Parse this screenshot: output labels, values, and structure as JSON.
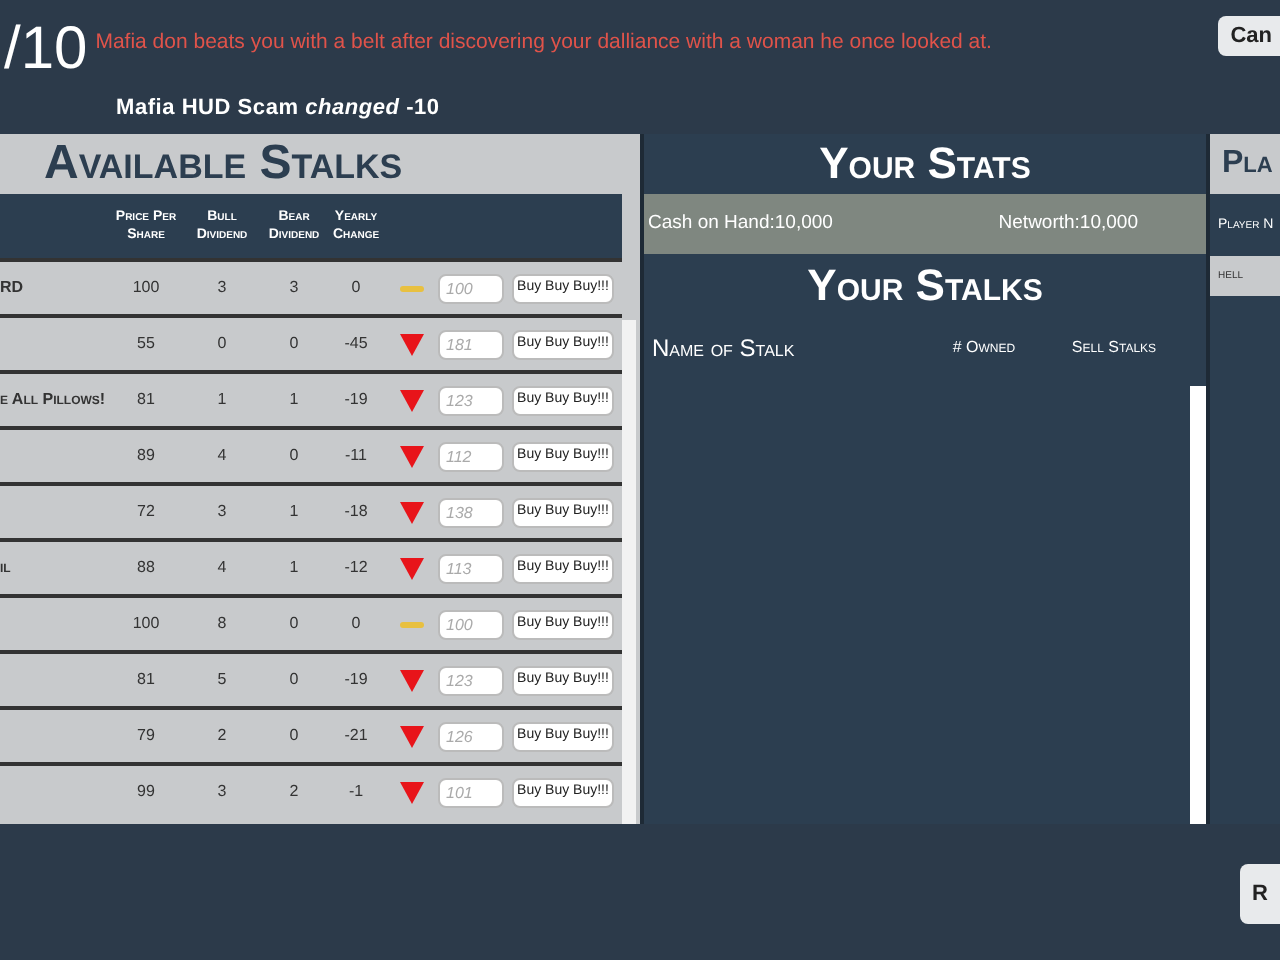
{
  "header": {
    "round": "/10",
    "message": "Mafia don beats you with a belt after discovering your dalliance with a woman he once looked at.",
    "event": "Mafia HUD Scam *changed* -10",
    "cancel_button": "Can"
  },
  "market": {
    "title": "Available Stalks",
    "columns": [
      "Price Per Share",
      "Bull Dividend",
      "Bear Dividend",
      "Yearly Change"
    ],
    "rows": [
      {
        "name": "RD",
        "price": "100",
        "bull": "3",
        "bear": "3",
        "change": "0",
        "kind": "flat",
        "placeholder": "100",
        "button": "Buy Buy Buy!!!"
      },
      {
        "price": "55",
        "bull": "0",
        "bear": "0",
        "change": "-45",
        "kind": "down",
        "placeholder": "181",
        "button": "Buy Buy Buy!!!"
      },
      {
        "name": "e All Pillows!",
        "price": "81",
        "bull": "1",
        "bear": "1",
        "change": "-19",
        "kind": "down",
        "placeholder": "123",
        "button": "Buy Buy Buy!!!"
      },
      {
        "price": "89",
        "bull": "4",
        "bear": "0",
        "change": "-11",
        "kind": "down",
        "placeholder": "112",
        "button": "Buy Buy Buy!!!"
      },
      {
        "price": "72",
        "bull": "3",
        "bear": "1",
        "change": "-18",
        "kind": "down",
        "placeholder": "138",
        "button": "Buy Buy Buy!!!"
      },
      {
        "name": "il",
        "price": "88",
        "bull": "4",
        "bear": "1",
        "change": "-12",
        "kind": "down",
        "placeholder": "113",
        "button": "Buy Buy Buy!!!"
      },
      {
        "price": "100",
        "bull": "8",
        "bear": "0",
        "change": "0",
        "kind": "flat",
        "placeholder": "100",
        "button": "Buy Buy Buy!!!"
      },
      {
        "price": "81",
        "bull": "5",
        "bear": "0",
        "change": "-19",
        "kind": "down",
        "placeholder": "123",
        "button": "Buy Buy Buy!!!"
      },
      {
        "price": "79",
        "bull": "2",
        "bear": "0",
        "change": "-21",
        "kind": "down",
        "placeholder": "126",
        "button": "Buy Buy Buy!!!"
      },
      {
        "price": "99",
        "bull": "3",
        "bear": "2",
        "change": "-1",
        "kind": "down",
        "placeholder": "101",
        "button": "Buy Buy Buy!!!"
      }
    ]
  },
  "stats": {
    "title": "Your Stats",
    "cash": "Cash on Hand:10,000",
    "networth": "Networth:10,000"
  },
  "holdings": {
    "title": "Your Stalks",
    "columns": [
      "Name of Stalk",
      "# Owned",
      "Sell Stalks"
    ]
  },
  "players": {
    "title": "Pla",
    "column": "Player N",
    "rows": [
      "hell"
    ]
  },
  "bottom_button": "R"
}
